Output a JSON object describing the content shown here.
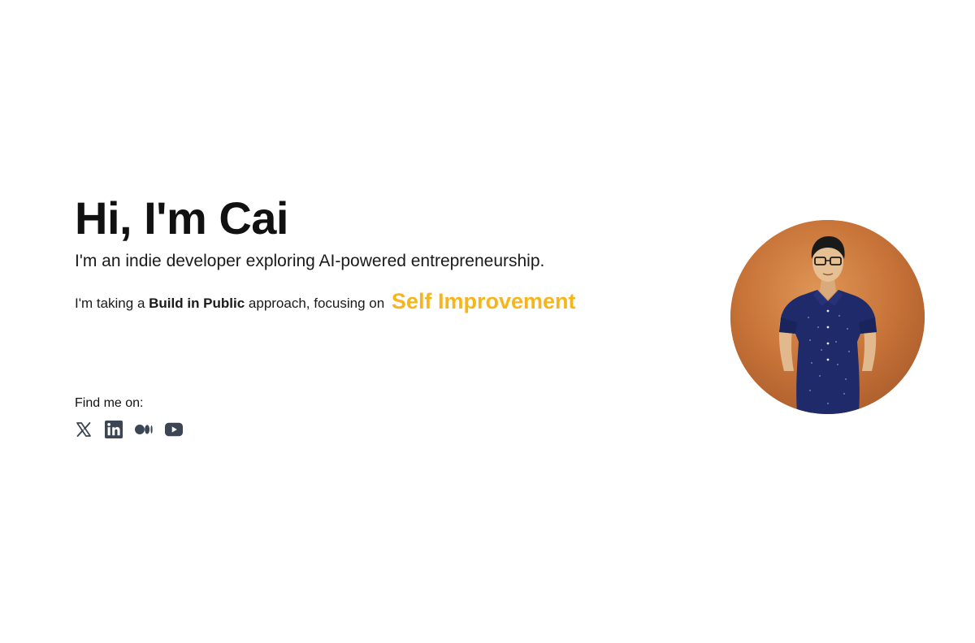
{
  "hero": {
    "title": "Hi, I'm Cai",
    "tagline": "I'm an indie developer exploring AI-powered entrepreneurship."
  },
  "approach": {
    "prefix": "I'm taking a ",
    "emphasis": "Build in Public",
    "middle": " approach, focusing on ",
    "focus": "Self Improvement",
    "focus_color": "#f6b51b"
  },
  "social": {
    "label": "Find me on:",
    "icon_color": "#3b4553",
    "links": [
      {
        "name": "x-icon"
      },
      {
        "name": "linkedin-icon"
      },
      {
        "name": "medium-icon"
      },
      {
        "name": "youtube-icon"
      }
    ]
  },
  "avatar": {
    "background": "#c8743a"
  }
}
